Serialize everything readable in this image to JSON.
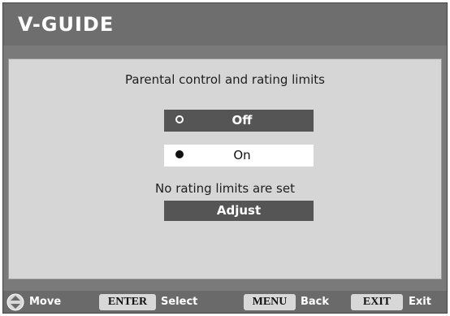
{
  "window": {
    "title": "V-GUIDE"
  },
  "main": {
    "heading": "Parental control and rating limits",
    "options": [
      {
        "label": "Off",
        "selected": false
      },
      {
        "label": "On",
        "selected": true
      }
    ],
    "status_text": "No rating limits are set",
    "adjust_label": "Adjust"
  },
  "footer": {
    "move_label": "Move",
    "enter_key": "ENTER",
    "enter_label": "Select",
    "menu_key": "MENU",
    "menu_label": "Back",
    "exit_key": "EXIT",
    "exit_label": "Exit"
  },
  "icons": {
    "nav": "up-down-arrows-icon"
  },
  "colors": {
    "frame": "#7a7a7a",
    "panel": "#d6d6d6",
    "highlight": "#555555",
    "selected": "#ffffff"
  }
}
